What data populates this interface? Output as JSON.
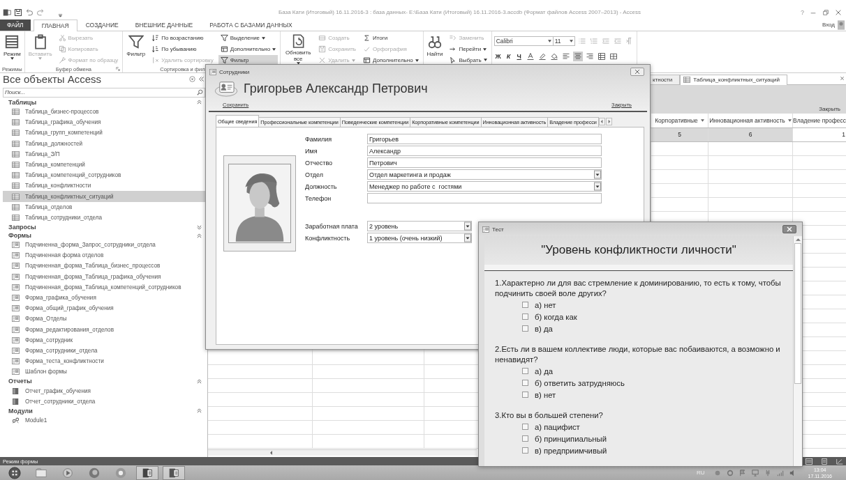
{
  "app": {
    "title": "База Кати (Итоговый) 16.11.2016-3 : база данных- E:\\База Кати (Итоговый) 16.11.2016-3.accdb (Формат файлов Access 2007–2013) - Access",
    "help": "?",
    "account": "Вход"
  },
  "ribbon_tabs": [
    {
      "label": "ФАЙЛ",
      "kind": "file",
      "selected": false
    },
    {
      "label": "ГЛАВНАЯ",
      "kind": "tab",
      "selected": true
    },
    {
      "label": "СОЗДАНИЕ",
      "kind": "tab",
      "selected": false
    },
    {
      "label": "ВНЕШНИЕ ДАННЫЕ",
      "kind": "tab",
      "selected": false
    },
    {
      "label": "РАБОТА С БАЗАМИ ДАННЫХ",
      "kind": "tab",
      "selected": false
    }
  ],
  "ribbon_groups": [
    {
      "kind": "commands",
      "label": "Режимы",
      "columns": [
        {
          "kind": "large",
          "items": [
            {
              "label": "Режим",
              "disabled": false,
              "selected": false,
              "dropdown": true
            }
          ]
        }
      ]
    },
    {
      "kind": "commands",
      "label": "Буфер обмена",
      "launcher": true,
      "columns": [
        {
          "kind": "large",
          "items": [
            {
              "label": "Вставить",
              "disabled": true,
              "selected": false,
              "dropdown": true
            }
          ]
        },
        {
          "kind": "small",
          "items": [
            {
              "label": "Вырезать",
              "disabled": true,
              "selected": false
            },
            {
              "label": "Копировать",
              "disabled": true,
              "selected": false
            },
            {
              "label": "Формат по образцу",
              "disabled": true,
              "selected": false
            }
          ]
        }
      ]
    },
    {
      "kind": "commands",
      "label": "Сортировка и фил",
      "columns": [
        {
          "kind": "large",
          "items": [
            {
              "label": "Фильтр",
              "disabled": false,
              "selected": false
            }
          ]
        },
        {
          "kind": "small",
          "items": [
            {
              "label": "По возрастанию",
              "disabled": false,
              "selected": false
            },
            {
              "label": "По убыванию",
              "disabled": false,
              "selected": false
            },
            {
              "label": "Удалить сортировку",
              "disabled": true,
              "selected": false
            }
          ]
        },
        {
          "kind": "small",
          "items": [
            {
              "label": "Выделение",
              "disabled": false,
              "selected": false,
              "dropdown": true
            },
            {
              "label": "Дополнительно",
              "disabled": false,
              "selected": false,
              "dropdown": true
            },
            {
              "label": "Фильтр",
              "disabled": false,
              "selected": true
            }
          ]
        }
      ]
    },
    {
      "kind": "commands",
      "columns": [
        {
          "kind": "large",
          "items": [
            {
              "label": "Обновить все",
              "disabled": false,
              "selected": false,
              "dropdown": true
            }
          ]
        },
        {
          "kind": "small",
          "items": [
            {
              "label": "Создать",
              "disabled": true,
              "selected": false
            },
            {
              "label": "Сохранить",
              "disabled": true,
              "selected": false
            },
            {
              "label": "Удалить",
              "disabled": true,
              "selected": false,
              "dropdown": true
            }
          ]
        },
        {
          "kind": "small",
          "items": [
            {
              "label": "Итоги",
              "disabled": false,
              "selected": false
            },
            {
              "label": "Орфография",
              "disabled": true,
              "selected": false
            },
            {
              "label": "Дополнительно",
              "disabled": false,
              "selected": false,
              "dropdown": true
            }
          ]
        }
      ]
    },
    {
      "kind": "commands",
      "columns": [
        {
          "kind": "large",
          "items": [
            {
              "label": "Найти",
              "disabled": false,
              "selected": false
            }
          ]
        },
        {
          "kind": "small",
          "items": [
            {
              "label": "Заменить",
              "disabled": true,
              "selected": false
            },
            {
              "label": "Перейти",
              "disabled": false,
              "selected": false,
              "dropdown": true
            },
            {
              "label": "Выбрать",
              "disabled": false,
              "selected": false,
              "dropdown": true
            }
          ]
        }
      ]
    },
    {
      "kind": "text_format",
      "font": "Calibri",
      "size": "11",
      "styles": [
        "Ж",
        "К",
        "Ч"
      ],
      "alignment_buttons": [
        {
          "selected": false
        },
        {
          "selected": true
        },
        {
          "selected": false
        }
      ]
    }
  ],
  "nav": {
    "title": "Все объекты Access",
    "search_placeholder": "Поиск...",
    "groups": [
      {
        "label": "Таблицы",
        "kind": "table",
        "expanded": true,
        "items": [
          {
            "label": "Таблица_бизнес-процессов",
            "selected": false
          },
          {
            "label": "Таблица_графика_обучения",
            "selected": false
          },
          {
            "label": "Таблица_групп_компетенций",
            "selected": false
          },
          {
            "label": "Таблица_должностей",
            "selected": false
          },
          {
            "label": "Таблица_З/П",
            "selected": false
          },
          {
            "label": "Таблица_компетенций",
            "selected": false
          },
          {
            "label": "Таблица_компетенций_сотрудников",
            "selected": false
          },
          {
            "label": "Таблица_конфликтности",
            "selected": false
          },
          {
            "label": "Таблица_конфликтных_ситуаций",
            "selected": true
          },
          {
            "label": "Таблица_отделов",
            "selected": false
          },
          {
            "label": "Таблица_сотрудники_отдела",
            "selected": false
          }
        ]
      },
      {
        "label": "Запросы",
        "expanded": false
      },
      {
        "label": "Формы",
        "kind": "form",
        "expanded": true,
        "items": [
          {
            "label": "Подчиненна_форма_Запрос_сотрудники_отдела",
            "selected": false
          },
          {
            "label": "Подчиненная форма отделов",
            "selected": false
          },
          {
            "label": "Подчиненная_форма_Таблица_бизнес_процессов",
            "selected": false
          },
          {
            "label": "Подчиненная_форма_Таблица_графика_обучения",
            "selected": false
          },
          {
            "label": "Подчиненная_форма_Таблица_компетенций_сотрудников",
            "selected": false
          },
          {
            "label": "Форма_графика_обучения",
            "selected": false
          },
          {
            "label": "Форма_общий_график_обучения",
            "selected": false
          },
          {
            "label": "Форма_Отделы",
            "selected": false
          },
          {
            "label": "Форма_редактирования_отделов",
            "selected": false
          },
          {
            "label": "Форма_сотрудник",
            "selected": false
          },
          {
            "label": "Форма_сотрудники_отдела",
            "selected": false
          },
          {
            "label": "Форма_теста_конфликтности",
            "selected": false
          },
          {
            "label": "Шаблон формы",
            "selected": false
          }
        ]
      },
      {
        "label": "Отчеты",
        "kind": "report",
        "expanded": true,
        "items": [
          {
            "label": "Отчет_график_обучения",
            "selected": false
          },
          {
            "label": "Отчет_сотрудники_отдела",
            "selected": false
          }
        ]
      },
      {
        "label": "Модули",
        "kind": "module",
        "expanded": true,
        "items": [
          {
            "label": "Module1",
            "selected": false
          }
        ]
      }
    ]
  },
  "document": {
    "tabs": [
      {
        "label": "ктности",
        "selected": false
      },
      {
        "label": "Таблица_конфликтных_ситуаций",
        "selected": true
      }
    ],
    "close": "Закрыть",
    "columns": [
      "Корпоративные",
      "Инновационная активность",
      "Владение професс"
    ],
    "rows": [
      [
        "5",
        "6",
        "1"
      ]
    ]
  },
  "employee_form": {
    "title": "Сотрудники",
    "heading": "Григорьев Александр Петрович",
    "save": "Сохранить",
    "close": "Закрыть",
    "tabs": [
      {
        "label": "Общие сведения",
        "selected": true
      },
      {
        "label": "Профессиональные компетенции",
        "selected": false
      },
      {
        "label": "Поведенческие компетенции",
        "selected": false
      },
      {
        "label": "Корпоративные компетенции",
        "selected": false
      },
      {
        "label": "Инновационная активность",
        "selected": false
      },
      {
        "label": "Владение професси",
        "selected": false
      }
    ],
    "personal_fields": [
      {
        "label": "Фамилия",
        "value": "Григорьев",
        "kind": "text"
      },
      {
        "label": "Имя",
        "value": "Александр",
        "kind": "text"
      },
      {
        "label": "Отчество",
        "value": "Петрович",
        "kind": "text"
      },
      {
        "label": "Отдел",
        "value": "Отдел маркетинга и продаж",
        "kind": "combo"
      },
      {
        "label": "Должность",
        "value": "Менеджер по работе с  гостями",
        "kind": "combo"
      },
      {
        "label": "Телефон",
        "kind": "text"
      }
    ],
    "rating_fields": [
      {
        "label": "Заработная плата",
        "value": "2 уровень",
        "kind": "combo"
      },
      {
        "label": "Конфликтность",
        "value": "1 уровень (очень низкий)",
        "kind": "combo"
      }
    ]
  },
  "test_form": {
    "title": "Тест",
    "heading": "\"Уровень конфликтности личности\"",
    "questions": [
      {
        "text": "1.Характерно ли для вас стремление к доминированию, то есть к тому, чтобы подчинить своей воле других?",
        "options": [
          {
            "label": "а) нет",
            "checked": false
          },
          {
            "label": "б) когда как",
            "checked": false
          },
          {
            "label": "в) да",
            "checked": false
          }
        ]
      },
      {
        "text": "2.Есть ли в вашем коллективе люди, которые вас побаиваются, а возможно и ненавидят?",
        "options": [
          {
            "label": "а) да",
            "checked": false
          },
          {
            "label": "б) ответить затрудняюсь",
            "checked": false
          },
          {
            "label": "в) нет",
            "checked": false
          }
        ]
      },
      {
        "text": "3.Кто вы в большей степени?",
        "options": [
          {
            "label": "а) пацифист",
            "checked": false
          },
          {
            "label": "б) принципиальный",
            "checked": false
          },
          {
            "label": "в) предприимчивый",
            "checked": false
          }
        ]
      }
    ]
  },
  "status_bar": {
    "mode": "Режим формы"
  },
  "taskbar": {
    "language": "RU",
    "time": "13:04",
    "date": "17.11.2016"
  }
}
